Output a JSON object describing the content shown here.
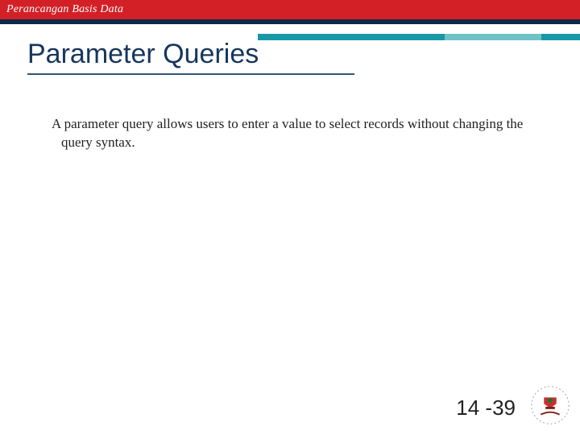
{
  "header": {
    "course": "Perancangan Basis Data"
  },
  "title": "Parameter Queries",
  "body": {
    "p1": "A parameter query allows users to enter a value to select records without changing the query syntax."
  },
  "footer": {
    "page": "14 -39"
  },
  "colors": {
    "brand_red": "#d32027",
    "brand_navy": "#0b2a4a",
    "accent_teal": "#1698a6",
    "title_color": "#16365d"
  }
}
